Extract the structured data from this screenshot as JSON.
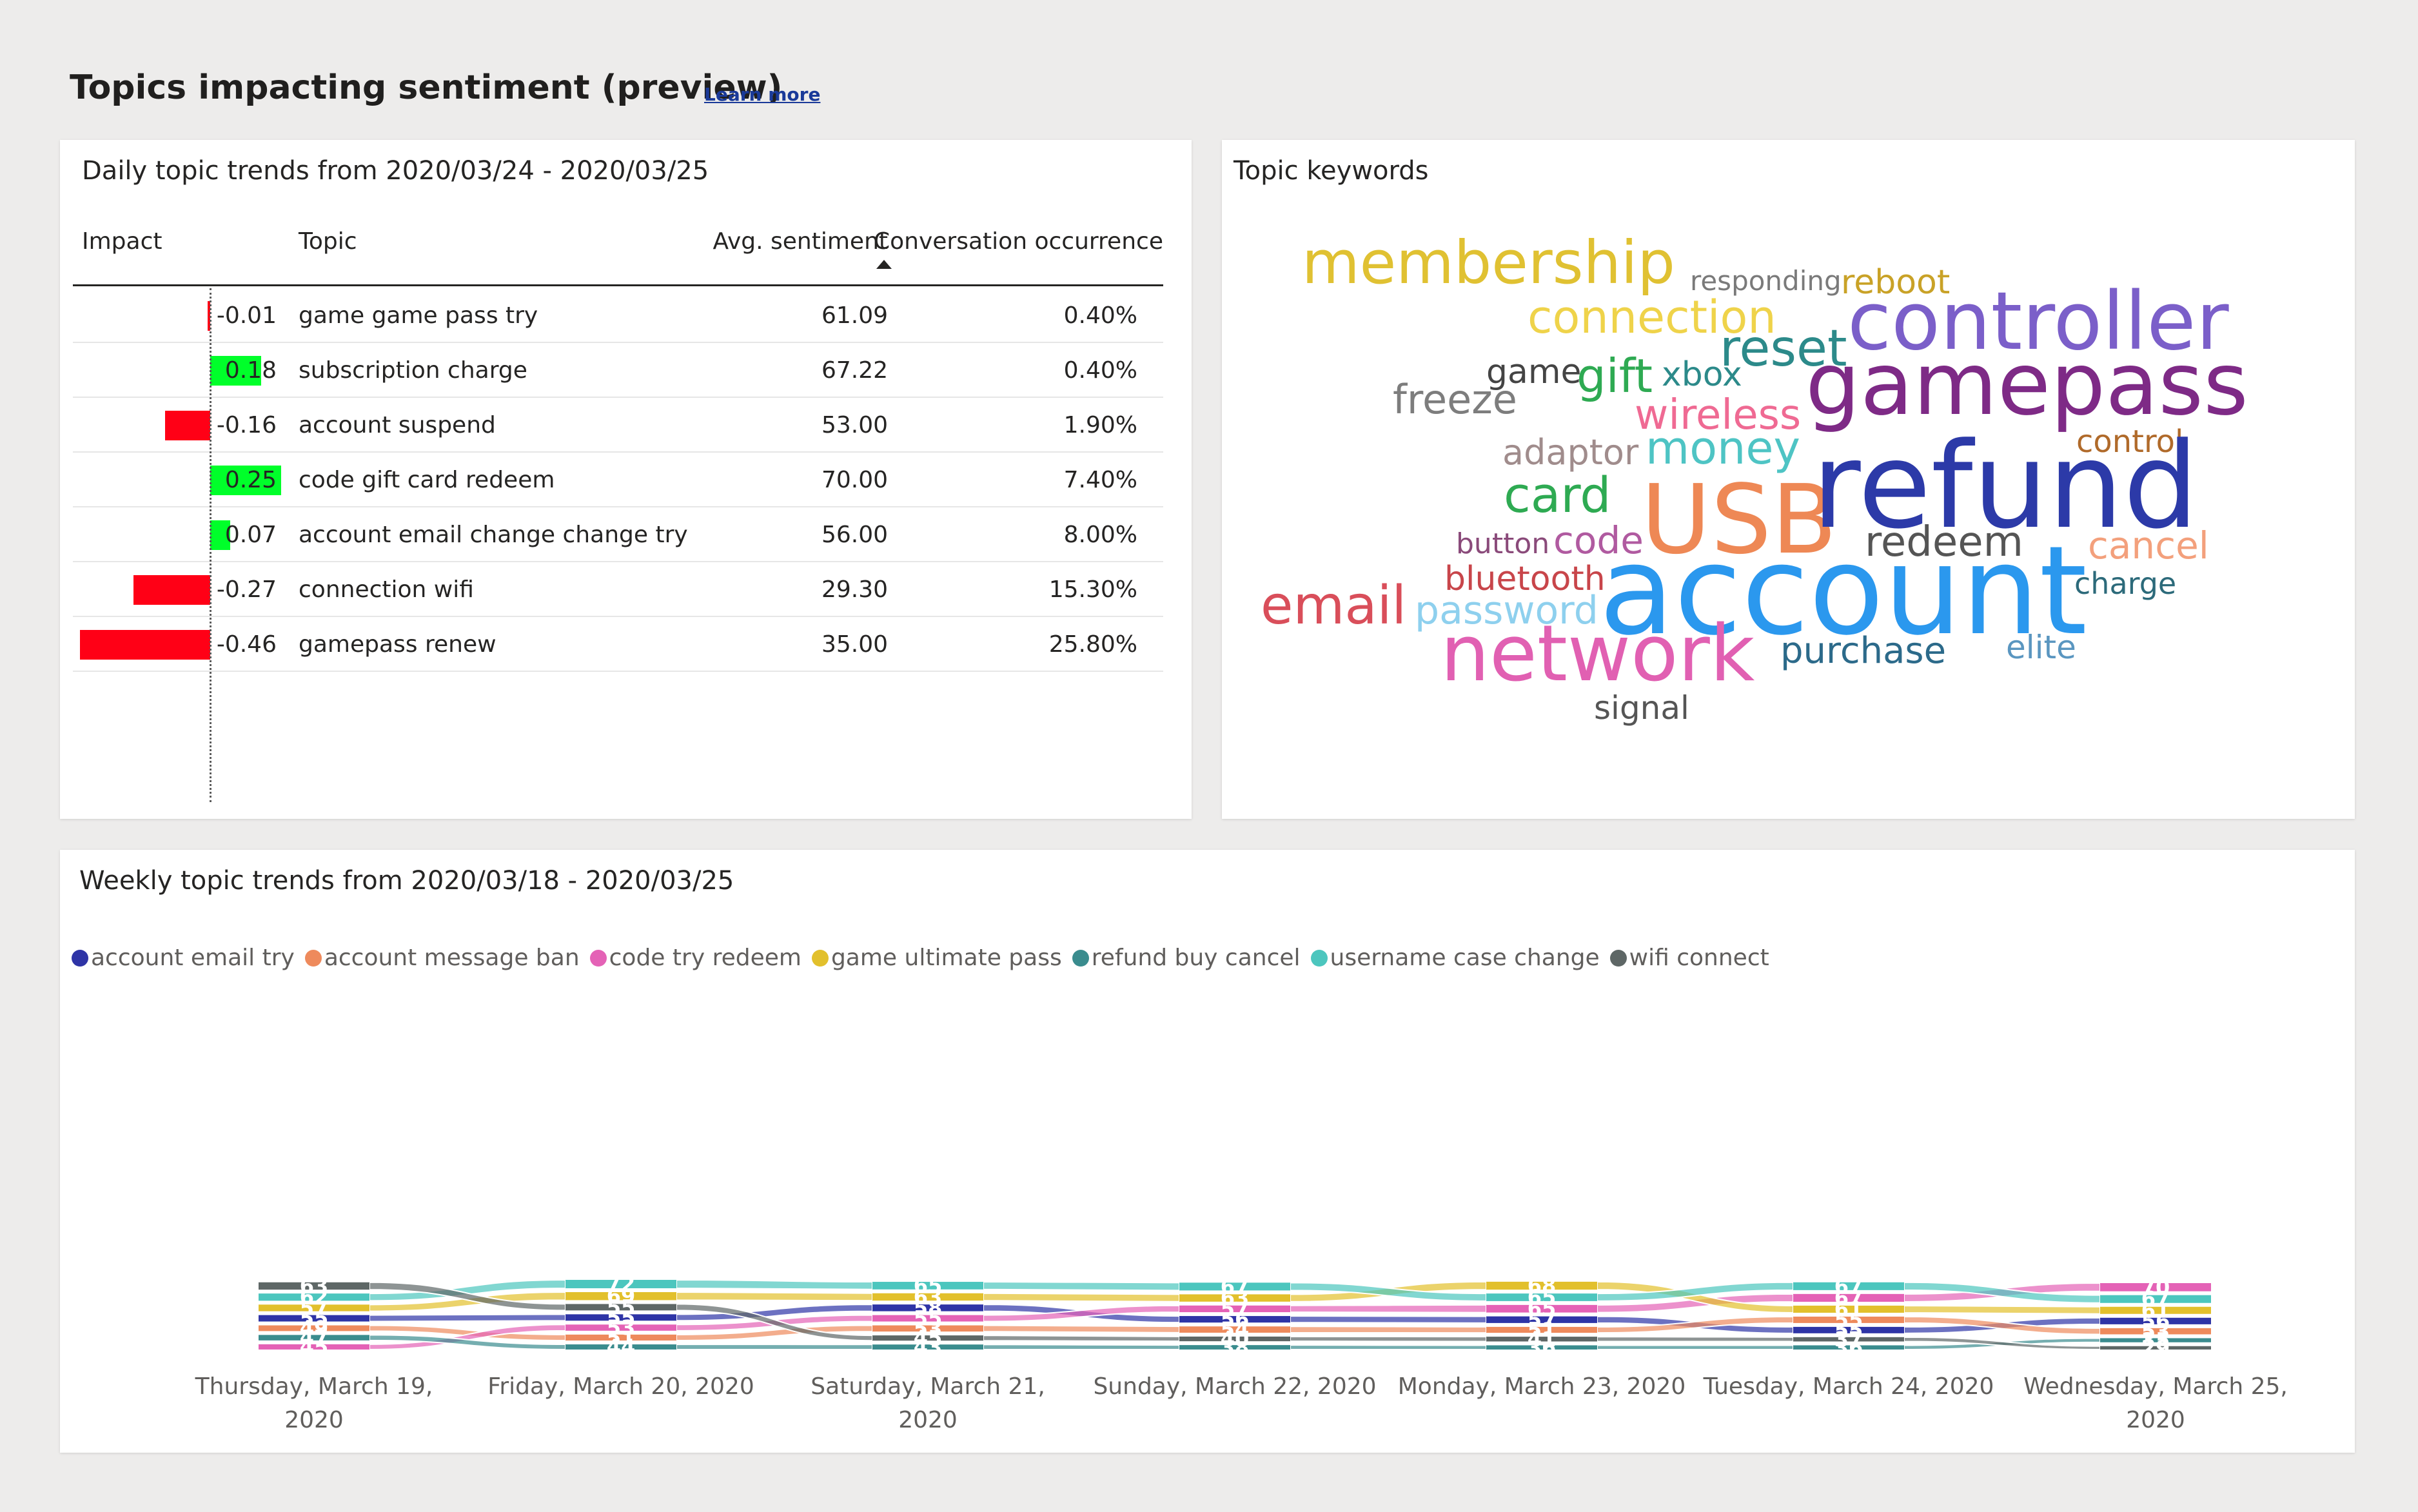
{
  "header": {
    "title": "Topics impacting sentiment (preview)",
    "learn_more": "Learn more"
  },
  "daily": {
    "title": "Daily topic trends from 2020/03/24 - 2020/03/25",
    "columns": {
      "impact": "Impact",
      "topic": "Topic",
      "avg_sentiment": "Avg. sentiment",
      "occurrence": "Conversation occurrence"
    },
    "rows": [
      {
        "impact": "-0.01",
        "topic": "game game pass try",
        "sentiment": "61.09",
        "occurrence": "0.40%"
      },
      {
        "impact": "0.18",
        "topic": "subscription charge",
        "sentiment": "67.22",
        "occurrence": "0.40%"
      },
      {
        "impact": "-0.16",
        "topic": "account suspend",
        "sentiment": "53.00",
        "occurrence": "1.90%"
      },
      {
        "impact": "0.25",
        "topic": "code gift card redeem",
        "sentiment": "70.00",
        "occurrence": "7.40%"
      },
      {
        "impact": "0.07",
        "topic": "account email change change try",
        "sentiment": "56.00",
        "occurrence": "8.00%"
      },
      {
        "impact": "-0.27",
        "topic": "connection wifi",
        "sentiment": "29.30",
        "occurrence": "15.30%"
      },
      {
        "impact": "-0.46",
        "topic": "gamepass renew",
        "sentiment": "35.00",
        "occurrence": "25.80%"
      }
    ],
    "colors": {
      "positive": "#00ff2a",
      "negative": "#ff0016"
    }
  },
  "keywords": {
    "title": "Topic keywords",
    "words": [
      {
        "text": "membership",
        "color": "#e0c132"
      },
      {
        "text": "responding",
        "color": "#7a7a7a"
      },
      {
        "text": "reboot",
        "color": "#c9a227"
      },
      {
        "text": "connection",
        "color": "#efd34a"
      },
      {
        "text": "controller",
        "color": "#7b5fc9"
      },
      {
        "text": "reset",
        "color": "#2c8a8a"
      },
      {
        "text": "game",
        "color": "#444444"
      },
      {
        "text": "gift",
        "color": "#2eaa52"
      },
      {
        "text": "xbox",
        "color": "#2c8a8a"
      },
      {
        "text": "gamepass",
        "color": "#7e2a86"
      },
      {
        "text": "freeze",
        "color": "#7d7d7d"
      },
      {
        "text": "wireless",
        "color": "#ef6a93"
      },
      {
        "text": "adaptor",
        "color": "#a08c8c"
      },
      {
        "text": "money",
        "color": "#4ec4c4"
      },
      {
        "text": "control",
        "color": "#b06a2a"
      },
      {
        "text": "card",
        "color": "#2eaa52"
      },
      {
        "text": "USB",
        "color": "#ee8855"
      },
      {
        "text": "refund",
        "color": "#2c3aa8"
      },
      {
        "text": "button",
        "color": "#8a4a7a"
      },
      {
        "text": "code",
        "color": "#b05aa0"
      },
      {
        "text": "redeem",
        "color": "#555555"
      },
      {
        "text": "cancel",
        "color": "#f3a07c"
      },
      {
        "text": "bluetooth",
        "color": "#c8454a"
      },
      {
        "text": "account",
        "color": "#2b98ee"
      },
      {
        "text": "charge",
        "color": "#2c6a7a"
      },
      {
        "text": "email",
        "color": "#d94e5a"
      },
      {
        "text": "password",
        "color": "#8ed0ee"
      },
      {
        "text": "network",
        "color": "#e160b2"
      },
      {
        "text": "purchase",
        "color": "#2c6a8a"
      },
      {
        "text": "elite",
        "color": "#5a96c0"
      },
      {
        "text": "signal",
        "color": "#555555"
      }
    ]
  },
  "weekly": {
    "title": "Weekly topic trends from 2020/03/18 - 2020/03/25",
    "legend": [
      {
        "name": "account email try",
        "color": "#2e34a6"
      },
      {
        "name": "account message ban",
        "color": "#ee8a5c"
      },
      {
        "name": "code try redeem",
        "color": "#e462b6"
      },
      {
        "name": "game ultimate pass",
        "color": "#e2c02c"
      },
      {
        "name": "refund buy cancel",
        "color": "#3a8c8e"
      },
      {
        "name": "username case change",
        "color": "#4cc6be"
      },
      {
        "name": "wifi connect",
        "color": "#5e6766"
      }
    ]
  },
  "chart_data": {
    "type": "ribbon",
    "categories": [
      [
        "Thursday, March 19,",
        "2020"
      ],
      [
        "Friday, March 20, 2020"
      ],
      [
        "Saturday, March 21,",
        "2020"
      ],
      [
        "Sunday, March 22, 2020"
      ],
      [
        "Monday, March 23, 2020"
      ],
      [
        "Tuesday, March 24, 2020"
      ],
      [
        "Wednesday, March 25,",
        "2020"
      ]
    ],
    "series": [
      {
        "name": "account email try",
        "values": [
          55,
          55,
          58,
          56,
          57,
          55,
          56
        ]
      },
      {
        "name": "account message ban",
        "values": [
          49,
          51,
          53,
          54,
          51,
          55,
          53
        ]
      },
      {
        "name": "code try redeem",
        "values": [
          45,
          53,
          55,
          57,
          65,
          67,
          70
        ]
      },
      {
        "name": "game ultimate pass",
        "values": [
          57,
          69,
          63,
          63,
          68,
          61,
          61
        ]
      },
      {
        "name": "refund buy cancel",
        "values": [
          47,
          44,
          43,
          38,
          36,
          36,
          35
        ]
      },
      {
        "name": "username case change",
        "values": [
          62,
          72,
          65,
          67,
          65,
          67,
          67
        ]
      },
      {
        "name": "wifi connect",
        "values": [
          63,
          55,
          45,
          40,
          41,
          37,
          29
        ]
      }
    ]
  }
}
